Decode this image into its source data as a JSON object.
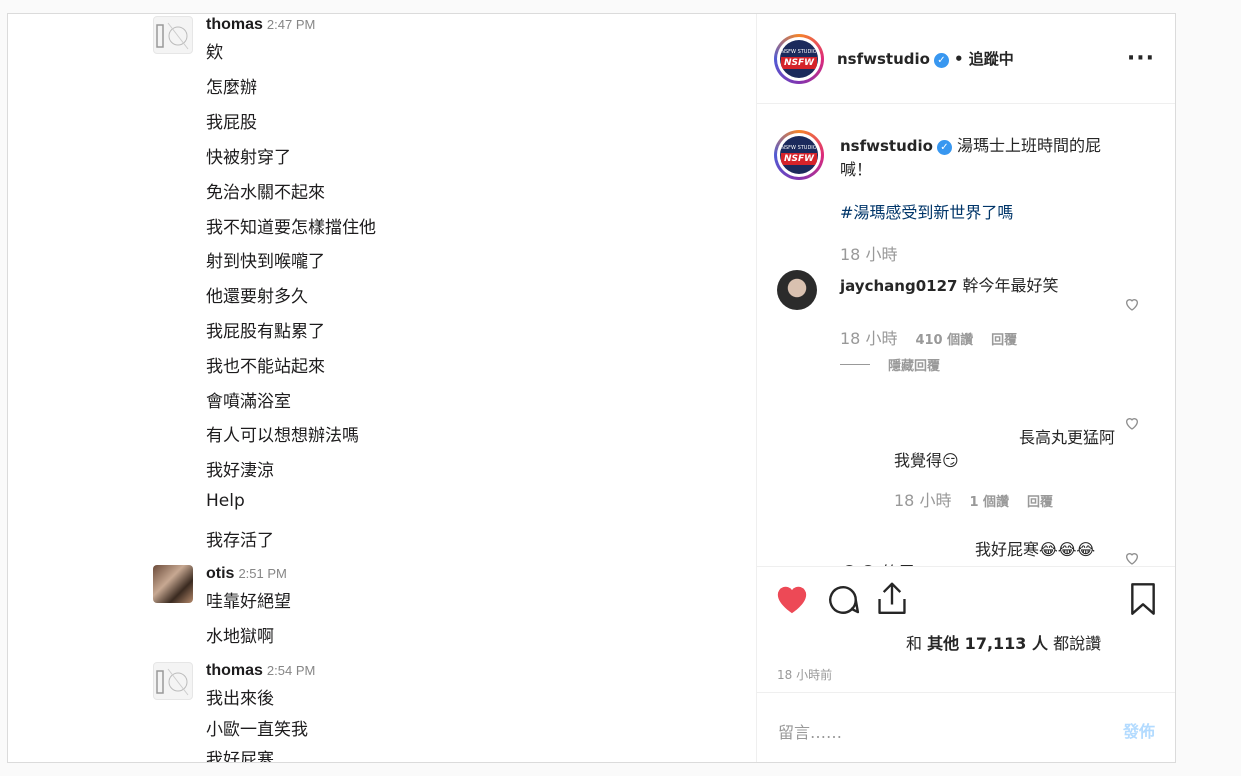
{
  "chat": {
    "groups": [
      {
        "sender": "thomas",
        "time": "2:47 PM",
        "lines": [
          "欸",
          "怎麼辦",
          "我屁股",
          "快被射穿了",
          "免治水關不起來",
          "我不知道要怎樣擋住他",
          "射到快到喉嚨了",
          "他還要射多久",
          "我屁股有點累了",
          "我也不能站起來",
          "會噴滿浴室",
          "有人可以想想辦法嗎",
          "我好淒涼",
          "Help",
          "我存活了"
        ]
      },
      {
        "sender": "otis",
        "time": "2:51 PM",
        "lines": [
          "哇靠好絕望",
          "水地獄啊"
        ]
      },
      {
        "sender": "thomas",
        "time": "2:54 PM",
        "lines": [
          "我出來後",
          "小歐一直笑我",
          "我好屁寒"
        ]
      }
    ]
  },
  "post": {
    "header": {
      "username": "nsfwstudio",
      "verified_icon": "verified-badge-icon",
      "separator": "•",
      "follow_status": "追蹤中",
      "more_icon": "more-options-icon"
    },
    "caption": {
      "username": "nsfwstudio",
      "text": "湯瑪士上班時間的屁喊！",
      "hashtag": "#湯瑪感受到新世界了嗎",
      "time": "18 小時"
    },
    "comments": [
      {
        "username": "jaychang0127",
        "text": "幹今年最好笑",
        "time": "18 小時",
        "likes": "410 個讚",
        "reply": "回覆",
        "hide_replies": "隱藏回覆"
      }
    ],
    "replies": [
      {
        "text": "長高丸更猛阿我覺得😏",
        "time": "18 小時",
        "likes": "1 個讚",
        "reply": "回覆"
      },
      {
        "text": "我好屁寒😂😂😂😂😂 笑屎",
        "time": ""
      }
    ],
    "likes_text_prefix": "和",
    "likes_text_bold": "其他 17,113 人",
    "likes_text_suffix": "都說讚",
    "timestamp": "18 小時前",
    "compose": {
      "placeholder": "留言……",
      "post_label": "發佈"
    },
    "colors": {
      "like_active": "#ed4956",
      "link": "#003569",
      "post_disabled": "#b3dbff"
    }
  }
}
